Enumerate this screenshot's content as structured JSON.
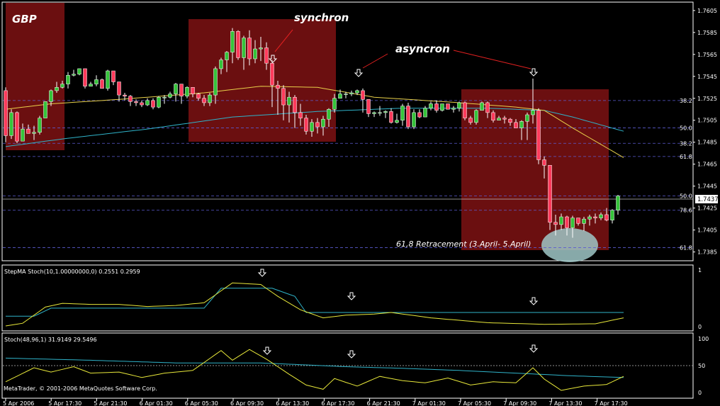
{
  "symbol": "GBP",
  "annotations": {
    "synchron": "synchron",
    "asyncron": "asyncron",
    "retracement": "61,8 Retracement (3.April- 5.April)"
  },
  "copyright": "MetaTrader, © 2001-2006 MetaQuotes Software Corp.",
  "colors": {
    "background": "#000000",
    "panel_border": "#ffffff",
    "zone": "#6b0f10",
    "bull": "#35c43a",
    "bear": "#ff3b5c",
    "ma_fast": "#e8d04a",
    "ma_slow": "#2fb3c9",
    "stoch_main": "#e8e83a",
    "stoch_signal": "#2fb3c9",
    "fib_line": "#5b5bd0",
    "ellipse": "#9fc7c7"
  },
  "x_axis_labels": [
    "5 Apr 2006",
    "5 Apr 17:30",
    "5 Apr 21:30",
    "6 Apr 01:30",
    "6 Apr 05:30",
    "6 Apr 09:30",
    "6 Apr 13:30",
    "6 Apr 17:30",
    "6 Apr 21:30",
    "7 Apr 01:30",
    "7 Apr 05:30",
    "7 Apr 09:30",
    "7 Apr 13:30",
    "7 Apr 17:30"
  ],
  "price_axis": [
    "1.7605",
    "1.7585",
    "1.7565",
    "1.7545",
    "1.7525",
    "1.7505",
    "1.7485",
    "1.7465",
    "1.7445",
    "1.7425",
    "1.7405",
    "1.7385"
  ],
  "current_price": "1.7437",
  "fib_levels": [
    {
      "label": "38.2",
      "price": 1.7523
    },
    {
      "label": "50.0",
      "price": 1.7498
    },
    {
      "label": "38.2",
      "price": 1.7484
    },
    {
      "label": "61.8",
      "price": 1.7472
    },
    {
      "label": "50.0",
      "price": 1.7436
    },
    {
      "label": "78.6",
      "price": 1.7423
    },
    {
      "label": "61.8",
      "price": 1.7389
    }
  ],
  "indicator1": {
    "label": "StepMA Stoch(10,1.00000000,0) 0.2551 0.2959",
    "axis": [
      "1",
      "0"
    ]
  },
  "indicator2": {
    "label": "Stoch(48,96,1) 31.9149 29.5496",
    "axis": [
      "100",
      "50",
      "0"
    ]
  },
  "chart_data": {
    "type": "candlestick",
    "ylim": [
      1.7377,
      1.7612
    ],
    "points": 109,
    "candles": [
      [
        1.7532,
        1.7491,
        1.7485,
        1.7535
      ],
      [
        1.7491,
        1.7512,
        1.7488,
        1.7515
      ],
      [
        1.7512,
        1.7486,
        1.7484,
        1.7513
      ],
      [
        1.7486,
        1.7497,
        1.7486,
        1.7502
      ],
      [
        1.7497,
        1.7493,
        1.7493,
        1.7501
      ],
      [
        1.7493,
        1.7494,
        1.7487,
        1.75
      ],
      [
        1.7494,
        1.7507,
        1.7492,
        1.7509
      ],
      [
        1.7507,
        1.7522,
        1.7507,
        1.7522
      ],
      [
        1.7522,
        1.7532,
        1.7518,
        1.7533
      ],
      [
        1.7532,
        1.7535,
        1.753,
        1.754
      ],
      [
        1.7535,
        1.7538,
        1.7534,
        1.7541
      ],
      [
        1.7538,
        1.7546,
        1.7534,
        1.7549
      ],
      [
        1.7546,
        1.7547,
        1.7545,
        1.7551
      ],
      [
        1.7547,
        1.7552,
        1.7546,
        1.7552
      ],
      [
        1.7552,
        1.7536,
        1.7534,
        1.7552
      ],
      [
        1.7536,
        1.7538,
        1.7536,
        1.754
      ],
      [
        1.7538,
        1.7542,
        1.7536,
        1.7546
      ],
      [
        1.7542,
        1.7534,
        1.7534,
        1.7543
      ],
      [
        1.7534,
        1.755,
        1.7532,
        1.7551
      ],
      [
        1.755,
        1.754,
        1.7537,
        1.755
      ],
      [
        1.754,
        1.7528,
        1.7522,
        1.754
      ],
      [
        1.7528,
        1.7527,
        1.7523,
        1.753
      ],
      [
        1.7527,
        1.7522,
        1.7518,
        1.7528
      ],
      [
        1.7522,
        1.7521,
        1.7518,
        1.7524
      ],
      [
        1.7521,
        1.7519,
        1.7517,
        1.7523
      ],
      [
        1.7519,
        1.7523,
        1.7518,
        1.7525
      ],
      [
        1.7523,
        1.7517,
        1.7515,
        1.7525
      ],
      [
        1.7517,
        1.7526,
        1.7516,
        1.7527
      ],
      [
        1.7526,
        1.7526,
        1.752,
        1.7528
      ],
      [
        1.7526,
        1.7529,
        1.7525,
        1.7531
      ],
      [
        1.7529,
        1.7538,
        1.7522,
        1.7539
      ],
      [
        1.7538,
        1.7527,
        1.752,
        1.7538
      ],
      [
        1.7527,
        1.7535,
        1.7525,
        1.7536
      ],
      [
        1.7535,
        1.7529,
        1.7526,
        1.7535
      ],
      [
        1.7529,
        1.7525,
        1.7523,
        1.753
      ],
      [
        1.7525,
        1.7521,
        1.7518,
        1.7528
      ],
      [
        1.7521,
        1.7528,
        1.7518,
        1.753
      ],
      [
        1.7528,
        1.7552,
        1.752,
        1.7554
      ],
      [
        1.7552,
        1.756,
        1.7547,
        1.7562
      ],
      [
        1.756,
        1.7567,
        1.7549,
        1.7568
      ],
      [
        1.7567,
        1.7586,
        1.7557,
        1.7589
      ],
      [
        1.7586,
        1.7562,
        1.756,
        1.7587
      ],
      [
        1.7562,
        1.758,
        1.7551,
        1.7582
      ],
      [
        1.758,
        1.7561,
        1.7555,
        1.7587
      ],
      [
        1.7561,
        1.757,
        1.7557,
        1.7578
      ],
      [
        1.757,
        1.7571,
        1.7559,
        1.7581
      ],
      [
        1.7571,
        1.7557,
        1.7551,
        1.7576
      ],
      [
        1.7557,
        1.7537,
        1.7517,
        1.756
      ],
      [
        1.7537,
        1.7534,
        1.751,
        1.7541
      ],
      [
        1.7534,
        1.7519,
        1.7505,
        1.7537
      ],
      [
        1.7519,
        1.7526,
        1.7503,
        1.7531
      ],
      [
        1.7526,
        1.7512,
        1.7498,
        1.7528
      ],
      [
        1.7512,
        1.7507,
        1.75,
        1.752
      ],
      [
        1.7507,
        1.7495,
        1.7492,
        1.751
      ],
      [
        1.7495,
        1.7503,
        1.749,
        1.7506
      ],
      [
        1.7503,
        1.7499,
        1.7493,
        1.7507
      ],
      [
        1.7499,
        1.7506,
        1.7491,
        1.7509
      ],
      [
        1.7506,
        1.7515,
        1.7499,
        1.7516
      ],
      [
        1.7515,
        1.7525,
        1.7512,
        1.7529
      ],
      [
        1.7525,
        1.7529,
        1.7525,
        1.7533
      ],
      [
        1.7529,
        1.7529,
        1.7525,
        1.7531
      ],
      [
        1.7529,
        1.753,
        1.7527,
        1.7532
      ],
      [
        1.753,
        1.7532,
        1.7528,
        1.7533
      ],
      [
        1.7532,
        1.7524,
        1.7512,
        1.7534
      ],
      [
        1.7524,
        1.7511,
        1.7508,
        1.7524
      ],
      [
        1.7511,
        1.7512,
        1.7508,
        1.7513
      ],
      [
        1.7512,
        1.7512,
        1.7509,
        1.7518
      ],
      [
        1.7512,
        1.7513,
        1.7507,
        1.7514
      ],
      [
        1.7513,
        1.7503,
        1.7502,
        1.7516
      ],
      [
        1.7503,
        1.7505,
        1.7502,
        1.7511
      ],
      [
        1.7505,
        1.7518,
        1.75,
        1.752
      ],
      [
        1.7518,
        1.7499,
        1.7497,
        1.7521
      ],
      [
        1.7499,
        1.7512,
        1.7497,
        1.7515
      ],
      [
        1.7512,
        1.7508,
        1.7507,
        1.7515
      ],
      [
        1.7508,
        1.7516,
        1.7508,
        1.7518
      ],
      [
        1.7516,
        1.752,
        1.7514,
        1.7522
      ],
      [
        1.752,
        1.7514,
        1.7512,
        1.7523
      ],
      [
        1.7514,
        1.752,
        1.7513,
        1.752
      ],
      [
        1.752,
        1.7515,
        1.7515,
        1.752
      ],
      [
        1.7515,
        1.7516,
        1.7512,
        1.7518
      ],
      [
        1.7516,
        1.7521,
        1.7513,
        1.7522
      ],
      [
        1.7521,
        1.7507,
        1.7505,
        1.7522
      ],
      [
        1.7507,
        1.7503,
        1.7501,
        1.7509
      ],
      [
        1.7503,
        1.7514,
        1.7501,
        1.7515
      ],
      [
        1.7514,
        1.7521,
        1.7514,
        1.7522
      ],
      [
        1.7521,
        1.7512,
        1.7507,
        1.7522
      ],
      [
        1.7512,
        1.7505,
        1.7503,
        1.7514
      ],
      [
        1.7505,
        1.7507,
        1.7505,
        1.7509
      ],
      [
        1.7507,
        1.7506,
        1.7502,
        1.7509
      ],
      [
        1.7506,
        1.7503,
        1.75,
        1.7507
      ],
      [
        1.7503,
        1.7498,
        1.7498,
        1.7506
      ],
      [
        1.7498,
        1.7504,
        1.7487,
        1.7505
      ],
      [
        1.7504,
        1.751,
        1.7487,
        1.7512
      ],
      [
        1.751,
        1.7514,
        1.7502,
        1.7543
      ],
      [
        1.7514,
        1.7469,
        1.7465,
        1.7516
      ],
      [
        1.7469,
        1.7464,
        1.7452,
        1.7472
      ],
      [
        1.7464,
        1.7412,
        1.7405,
        1.7464
      ],
      [
        1.7412,
        1.741,
        1.74,
        1.7419
      ],
      [
        1.741,
        1.7417,
        1.7405,
        1.742
      ],
      [
        1.7417,
        1.7407,
        1.74,
        1.7418
      ],
      [
        1.7407,
        1.7416,
        1.7398,
        1.7418
      ],
      [
        1.7416,
        1.7411,
        1.7409,
        1.7416
      ],
      [
        1.7411,
        1.7415,
        1.7404,
        1.7417
      ],
      [
        1.7415,
        1.7417,
        1.7409,
        1.7419
      ],
      [
        1.7417,
        1.7416,
        1.7411,
        1.742
      ],
      [
        1.7416,
        1.7419,
        1.7414,
        1.7421
      ],
      [
        1.7419,
        1.7414,
        1.7413,
        1.7425
      ],
      [
        1.7414,
        1.7423,
        1.7411,
        1.7424
      ],
      [
        1.7423,
        1.7436,
        1.7419,
        1.7437
      ]
    ],
    "series": [
      {
        "name": "MA fast",
        "anchors": [
          [
            0,
            1.7515
          ],
          [
            8,
            1.752
          ],
          [
            20,
            1.7524
          ],
          [
            35,
            1.753
          ],
          [
            45,
            1.7536
          ],
          [
            55,
            1.7535
          ],
          [
            65,
            1.7526
          ],
          [
            80,
            1.7521
          ],
          [
            90,
            1.7517
          ],
          [
            95,
            1.7514
          ],
          [
            100,
            1.7498
          ],
          [
            109,
            1.7471
          ]
        ]
      },
      {
        "name": "MA slow",
        "anchors": [
          [
            0,
            1.7481
          ],
          [
            10,
            1.7488
          ],
          [
            25,
            1.7497
          ],
          [
            40,
            1.7508
          ],
          [
            55,
            1.7513
          ],
          [
            70,
            1.7516
          ],
          [
            85,
            1.7516
          ],
          [
            95,
            1.7514
          ],
          [
            100,
            1.7508
          ],
          [
            109,
            1.7495
          ]
        ]
      },
      {
        "name": "StepMA Stoch main",
        "anchors": [
          [
            0,
            0
          ],
          [
            3,
            0.05
          ],
          [
            7,
            0.35
          ],
          [
            10,
            0.42
          ],
          [
            15,
            0.4
          ],
          [
            20,
            0.4
          ],
          [
            25,
            0.36
          ],
          [
            30,
            0.38
          ],
          [
            35,
            0.43
          ],
          [
            40,
            0.8
          ],
          [
            45,
            0.77
          ],
          [
            48,
            0.55
          ],
          [
            52,
            0.3
          ],
          [
            56,
            0.15
          ],
          [
            60,
            0.2
          ],
          [
            65,
            0.22
          ],
          [
            68,
            0.25
          ],
          [
            75,
            0.15
          ],
          [
            85,
            0.06
          ],
          [
            95,
            0.03
          ],
          [
            104,
            0.04
          ],
          [
            109,
            0.15
          ]
        ]
      },
      {
        "name": "StepMA Stoch signal",
        "anchors": [
          [
            0,
            0.18
          ],
          [
            5,
            0.18
          ],
          [
            8,
            0.33
          ],
          [
            35,
            0.33
          ],
          [
            38,
            0.7
          ],
          [
            47,
            0.7
          ],
          [
            51,
            0.55
          ],
          [
            53,
            0.25
          ],
          [
            109,
            0.25
          ]
        ]
      },
      {
        "name": "Stoch main",
        "anchors": [
          [
            0,
            20
          ],
          [
            5,
            46
          ],
          [
            8,
            38
          ],
          [
            12,
            48
          ],
          [
            15,
            36
          ],
          [
            20,
            38
          ],
          [
            24,
            28
          ],
          [
            28,
            36
          ],
          [
            33,
            41
          ],
          [
            38,
            78
          ],
          [
            40,
            60
          ],
          [
            43,
            80
          ],
          [
            46,
            62
          ],
          [
            50,
            34
          ],
          [
            53,
            14
          ],
          [
            56,
            6
          ],
          [
            58,
            26
          ],
          [
            62,
            12
          ],
          [
            66,
            30
          ],
          [
            70,
            22
          ],
          [
            74,
            18
          ],
          [
            78,
            27
          ],
          [
            82,
            14
          ],
          [
            86,
            20
          ],
          [
            90,
            18
          ],
          [
            93,
            46
          ],
          [
            95,
            25
          ],
          [
            98,
            4
          ],
          [
            102,
            12
          ],
          [
            106,
            15
          ],
          [
            109,
            30
          ]
        ]
      },
      {
        "name": "Stoch signal",
        "anchors": [
          [
            0,
            64
          ],
          [
            15,
            60
          ],
          [
            30,
            55
          ],
          [
            45,
            55
          ],
          [
            60,
            48
          ],
          [
            70,
            45
          ],
          [
            80,
            41
          ],
          [
            90,
            36
          ],
          [
            100,
            31
          ],
          [
            109,
            28
          ]
        ]
      }
    ]
  }
}
